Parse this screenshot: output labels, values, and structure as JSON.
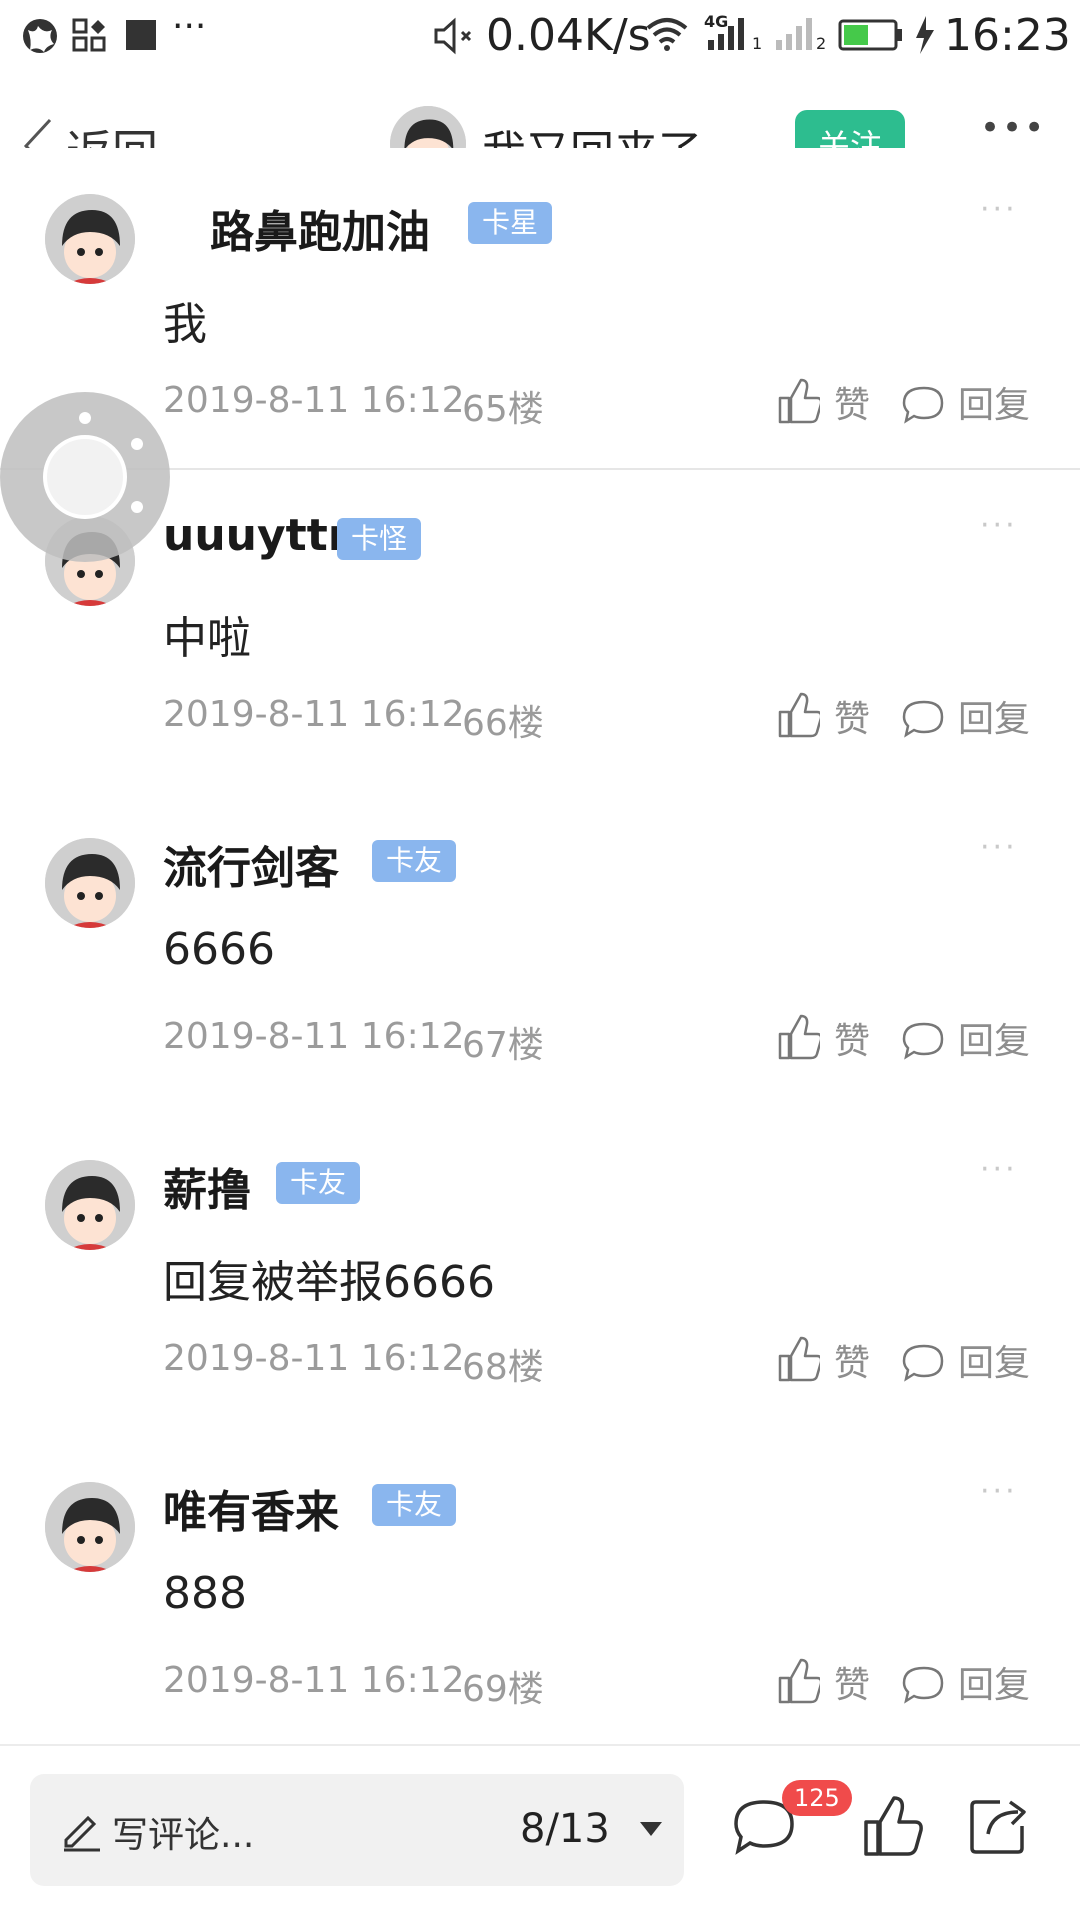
{
  "status_bar": {
    "net_speed": "0.04K/s",
    "network_label": "4G",
    "sim1": "1",
    "sim2": "2",
    "time": "16:23",
    "more_dots": "···"
  },
  "nav": {
    "back_label": "返回",
    "title": "我又回来了",
    "follow_label": "关注",
    "more_dots": "•••"
  },
  "posts": [
    {
      "username": "路鼻跑加油",
      "badge": "卡星",
      "content": "我",
      "time": "2019-8-11 16:12",
      "floor": "65楼",
      "like": "赞",
      "reply": "回复"
    },
    {
      "username": "uuuyttr",
      "badge": "卡怪",
      "content": "中啦",
      "time": "2019-8-11 16:12",
      "floor": "66楼",
      "like": "赞",
      "reply": "回复"
    },
    {
      "username": "流行剑客",
      "badge": "卡友",
      "content": "6666",
      "time": "2019-8-11 16:12",
      "floor": "67楼",
      "like": "赞",
      "reply": "回复"
    },
    {
      "username": "薪撸",
      "badge": "卡友",
      "content": "回复被举报6666",
      "time": "2019-8-11 16:12",
      "floor": "68楼",
      "like": "赞",
      "reply": "回复"
    },
    {
      "username": "唯有香来",
      "badge": "卡友",
      "content": "888",
      "time": "2019-8-11 16:12",
      "floor": "69楼",
      "like": "赞",
      "reply": "回复"
    }
  ],
  "post_more": "···",
  "bottom": {
    "comment_placeholder": "写评论...",
    "page_indicator": "8/13",
    "comment_count": "125"
  },
  "colors": {
    "follow": "#2dbd8f",
    "badge": "#8ab6ee",
    "count_badge": "#f04b4b"
  }
}
